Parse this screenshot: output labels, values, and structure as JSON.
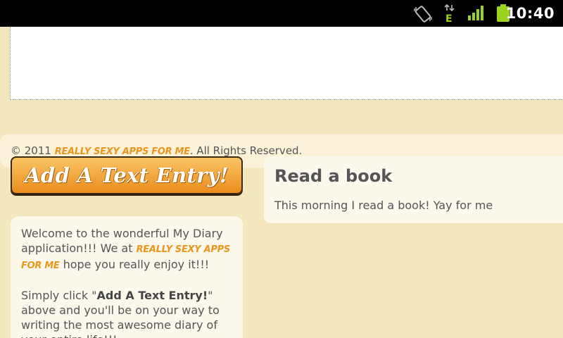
{
  "status_bar": {
    "time": "10:40",
    "icons": [
      "rotate-icon",
      "data-e-icon",
      "signal-icon",
      "battery-icon"
    ],
    "network_letter": "E"
  },
  "footer": {
    "copyright_prefix": "© 2011",
    "brand": "REALLY SEXY APPS FOR ME",
    "copyright_suffix": ". All Rights Reserved."
  },
  "add_entry_button": {
    "label": "Add A Text Entry!"
  },
  "entry": {
    "title": "Read a book",
    "text": "This morning I read a book! Yay for me"
  },
  "welcome": {
    "p1_start": "Welcome to the wonderful My Diary application!!! We at",
    "p1_brand": "REALLY SEXY APPS FOR ME",
    "p1_end": "hope you really enjoy it!!!",
    "p2_start": "Simply click \"",
    "p2_bold": "Add A Text Entry!",
    "p2_end": "\" above and you'll be on your way to writing the most awesome diary of your entire life!!!"
  },
  "colors": {
    "background": "#f4e6bd",
    "accent": "#e8971c",
    "card": "#fcf8ec"
  }
}
